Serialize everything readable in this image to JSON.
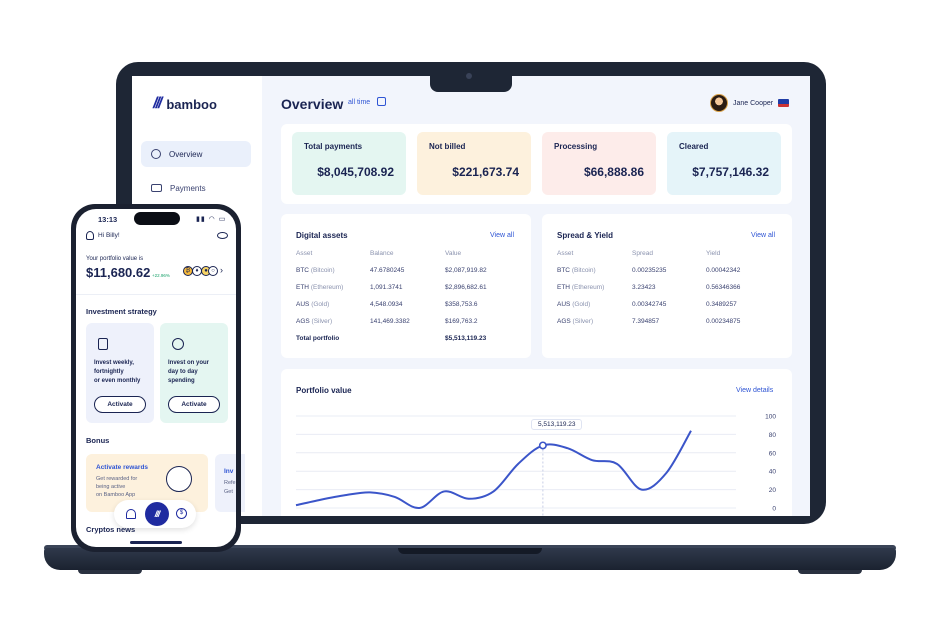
{
  "laptop": {
    "brand": "bamboo",
    "sidebar": {
      "items": [
        {
          "label": "Overview",
          "icon": "pie-chart-icon",
          "active": true
        },
        {
          "label": "Payments",
          "icon": "card-icon",
          "active": false
        }
      ]
    },
    "header": {
      "title": "Overview",
      "range_label": "all time",
      "user_name": "Jane Cooper"
    },
    "stats": [
      {
        "label": "Total payments",
        "value": "$8,045,708.92",
        "color": "#e4f6f1"
      },
      {
        "label": "Not billed",
        "value": "$221,673.74",
        "color": "#fdf1dd"
      },
      {
        "label": "Processing",
        "value": "$66,888.86",
        "color": "#fdecea"
      },
      {
        "label": "Cleared",
        "value": "$7,757,146.32",
        "color": "#e5f4f9"
      }
    ],
    "digital_assets": {
      "title": "Digital assets",
      "link": "View all",
      "headers": [
        "Asset",
        "Balance",
        "Value"
      ],
      "rows": [
        {
          "ticker": "BTC",
          "name": "(Bitcoin)",
          "balance": "47.6780245",
          "value": "$2,087,919.82"
        },
        {
          "ticker": "ETH",
          "name": "(Ethereum)",
          "balance": "1,091.3741",
          "value": "$2,896,682.61"
        },
        {
          "ticker": "AUS",
          "name": "(Gold)",
          "balance": "4,548.0934",
          "value": "$358,753.6"
        },
        {
          "ticker": "AGS",
          "name": "(Silver)",
          "balance": "141,469.3382",
          "value": "$169,763.2"
        }
      ],
      "total_label": "Total portfolio",
      "total_value": "$5,513,119.23"
    },
    "spread_yield": {
      "title": "Spread & Yield",
      "link": "View all",
      "headers": [
        "Asset",
        "Spread",
        "Yield"
      ],
      "rows": [
        {
          "ticker": "BTC",
          "name": "(Bitcoin)",
          "spread": "0.00235235",
          "yield": "0.00042342"
        },
        {
          "ticker": "ETH",
          "name": "(Ethereum)",
          "spread": "3.23423",
          "yield": "0.56346366"
        },
        {
          "ticker": "AUS",
          "name": "(Gold)",
          "spread": "0.00342745",
          "yield": "0.3489257"
        },
        {
          "ticker": "AGS",
          "name": "(Silver)",
          "spread": "7.394857",
          "yield": "0.00234875"
        }
      ]
    },
    "portfolio": {
      "title": "Portfolio value",
      "link": "View details",
      "tooltip": "5,513,119.23"
    }
  },
  "chart_data": {
    "type": "line",
    "ylim": [
      0,
      100
    ],
    "yticks": [
      100,
      80,
      60,
      40,
      20,
      0
    ],
    "x": [
      0,
      1,
      2,
      3,
      4,
      5,
      6,
      7,
      8,
      9,
      10,
      11,
      12,
      13,
      14,
      15,
      16
    ],
    "values": [
      3,
      9,
      14,
      17,
      12,
      0,
      18,
      10,
      18,
      48,
      68,
      65,
      52,
      48,
      20,
      38,
      84
    ],
    "highlight_index": 10,
    "accent": "#3b55c9"
  },
  "phone": {
    "time": "13:13",
    "greeting": "Hi Billy!",
    "portfolio_label": "Your portfolio value is",
    "portfolio_value": "$11,680.62",
    "change": "+22.96%",
    "strategy_title": "Investment strategy",
    "strategies": [
      {
        "text": [
          "Invest weekly,",
          "fortnightly",
          "or even monthly"
        ],
        "button": "Activate",
        "color": "#eef1fb"
      },
      {
        "text": [
          "Invest on your",
          "day to day",
          "spending"
        ],
        "button": "Activate",
        "color": "#e4f6f1"
      }
    ],
    "bonus_title": "Bonus",
    "bonus_card": {
      "title": "Activate rewards",
      "text": [
        "Get rewarded for",
        "being active",
        "on Bamboo App"
      ],
      "color": "#fdf1dd"
    },
    "bonus_card2_title": "Inv",
    "bonus_card2_text": [
      "Refe",
      "Get"
    ],
    "cryptos_title": "Cryptos news"
  }
}
